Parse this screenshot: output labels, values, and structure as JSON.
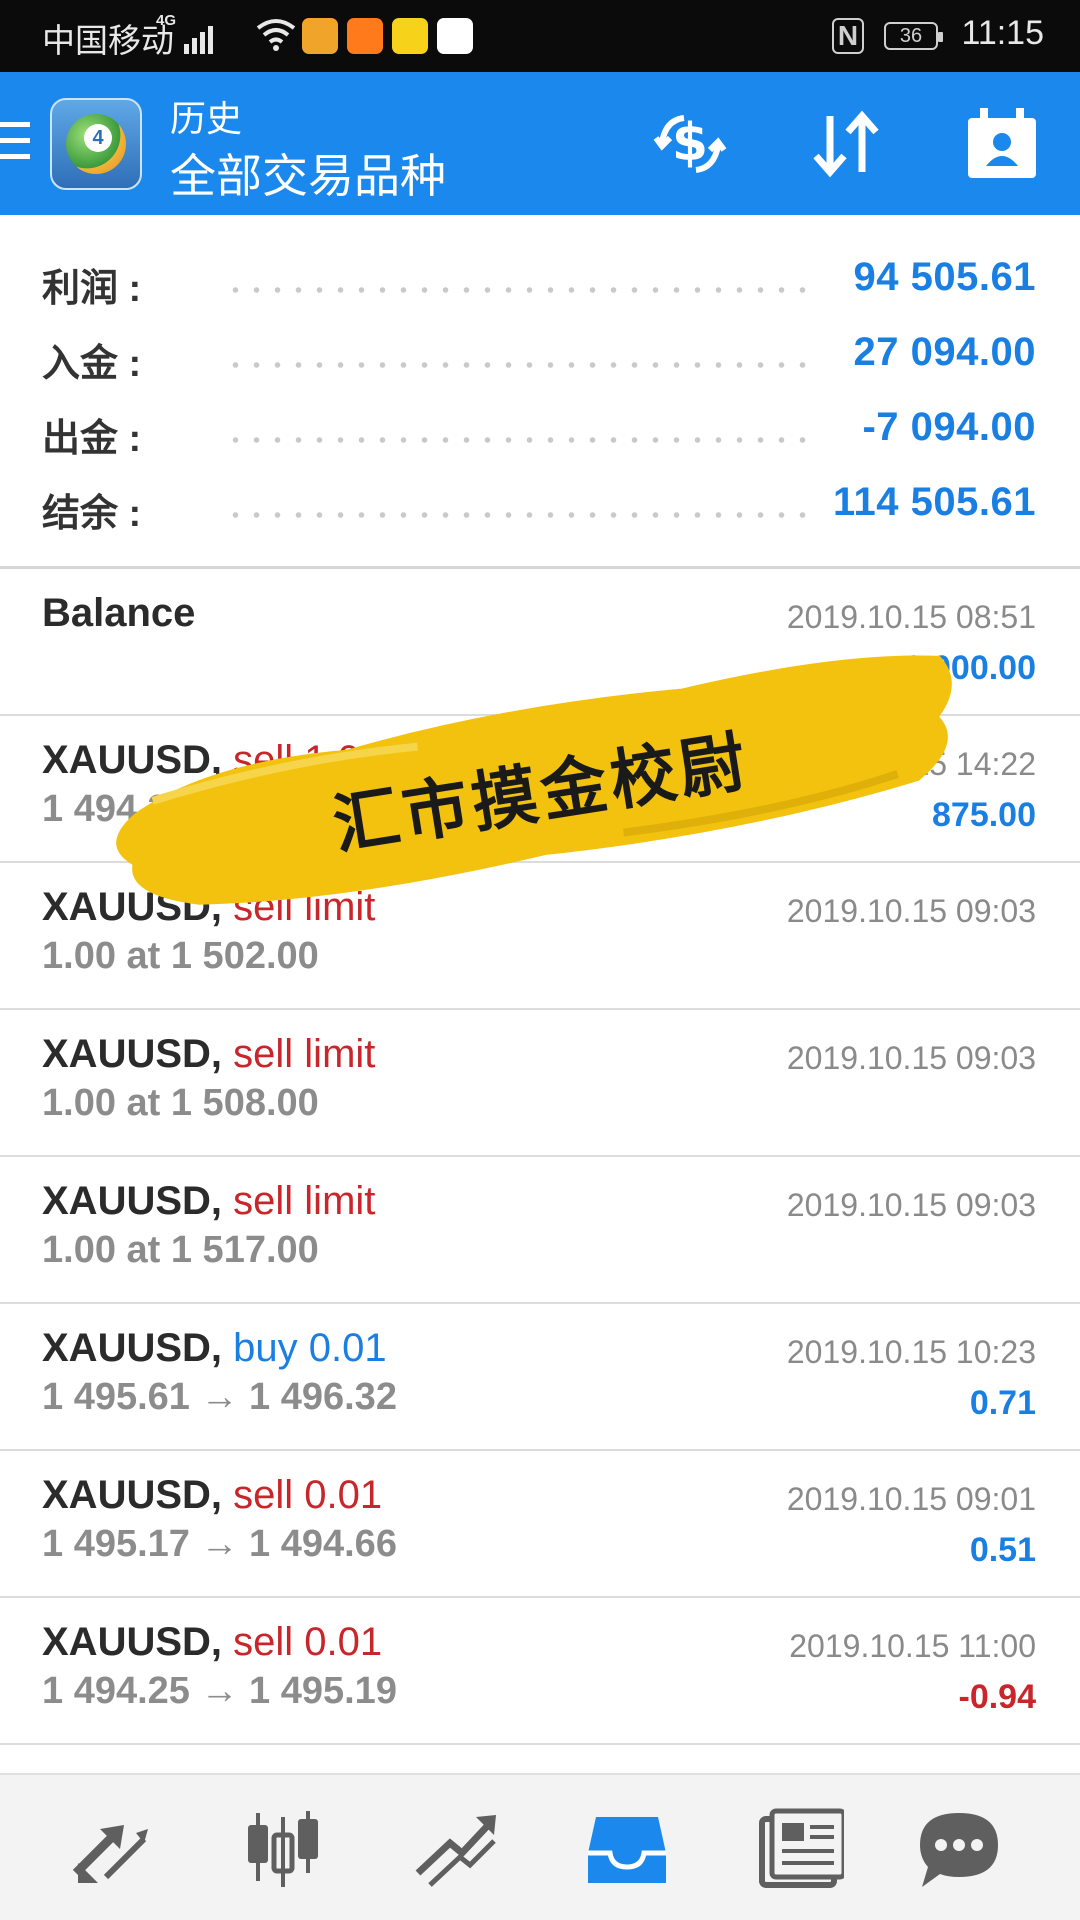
{
  "status_bar": {
    "carrier": "中国移动",
    "network": "4G",
    "battery": "36",
    "time": "11:15"
  },
  "app_bar": {
    "title": "历史",
    "subtitle": "全部交易品种",
    "icons": [
      "menu-icon",
      "app-logo",
      "currency-exchange-icon",
      "sort-icon",
      "calendar-account-icon"
    ]
  },
  "summary": [
    {
      "label": "利润 :",
      "value": "94 505.61"
    },
    {
      "label": "入金 :",
      "value": "27 094.00"
    },
    {
      "label": "出金 :",
      "value": "-7 094.00"
    },
    {
      "label": "结余 :",
      "value": "114 505.61"
    }
  ],
  "history": [
    {
      "symbol": "Balance",
      "type": "",
      "type_color": "",
      "detail": "",
      "time": "2019.10.15 08:51",
      "amount": "6 000.00",
      "amount_negative": false
    },
    {
      "symbol": "XAUUSD,",
      "type": "sell 1.00",
      "type_color": "red",
      "detail": "1 494.3",
      "time": "19.10.15 14:22",
      "amount": "875.00",
      "amount_negative": false
    },
    {
      "symbol": "XAUUSD,",
      "type": "sell limit",
      "type_color": "red",
      "detail": "1.00 at 1 502.00",
      "time": "2019.10.15 09:03",
      "amount": "",
      "amount_negative": false
    },
    {
      "symbol": "XAUUSD,",
      "type": "sell limit",
      "type_color": "red",
      "detail": "1.00 at 1 508.00",
      "time": "2019.10.15 09:03",
      "amount": "",
      "amount_negative": false
    },
    {
      "symbol": "XAUUSD,",
      "type": "sell limit",
      "type_color": "red",
      "detail": "1.00 at 1 517.00",
      "time": "2019.10.15 09:03",
      "amount": "",
      "amount_negative": false
    },
    {
      "symbol": "XAUUSD,",
      "type": "buy 0.01",
      "type_color": "blue",
      "detail": "1 495.61 → 1 496.32",
      "time": "2019.10.15 10:23",
      "amount": "0.71",
      "amount_negative": false
    },
    {
      "symbol": "XAUUSD,",
      "type": "sell 0.01",
      "type_color": "red",
      "detail": "1 495.17 → 1 494.66",
      "time": "2019.10.15 09:01",
      "amount": "0.51",
      "amount_negative": false
    },
    {
      "symbol": "XAUUSD,",
      "type": "sell 0.01",
      "type_color": "red",
      "detail": "1 494.25 → 1 495.19",
      "time": "2019.10.15 11:00",
      "amount": "-0.94",
      "amount_negative": true
    }
  ],
  "watermark": {
    "text": "汇市摸金校尉"
  },
  "bottom_nav": [
    {
      "name": "quotes-icon",
      "active": false
    },
    {
      "name": "chart-icon",
      "active": false
    },
    {
      "name": "trade-icon",
      "active": false
    },
    {
      "name": "history-icon",
      "active": true
    },
    {
      "name": "news-icon",
      "active": false
    },
    {
      "name": "messages-icon",
      "active": false
    }
  ],
  "colors": {
    "accent": "#1b88ee",
    "value_blue": "#1a7fe3",
    "sell_red": "#c8262b",
    "watermark_yellow": "#f2c20f"
  }
}
